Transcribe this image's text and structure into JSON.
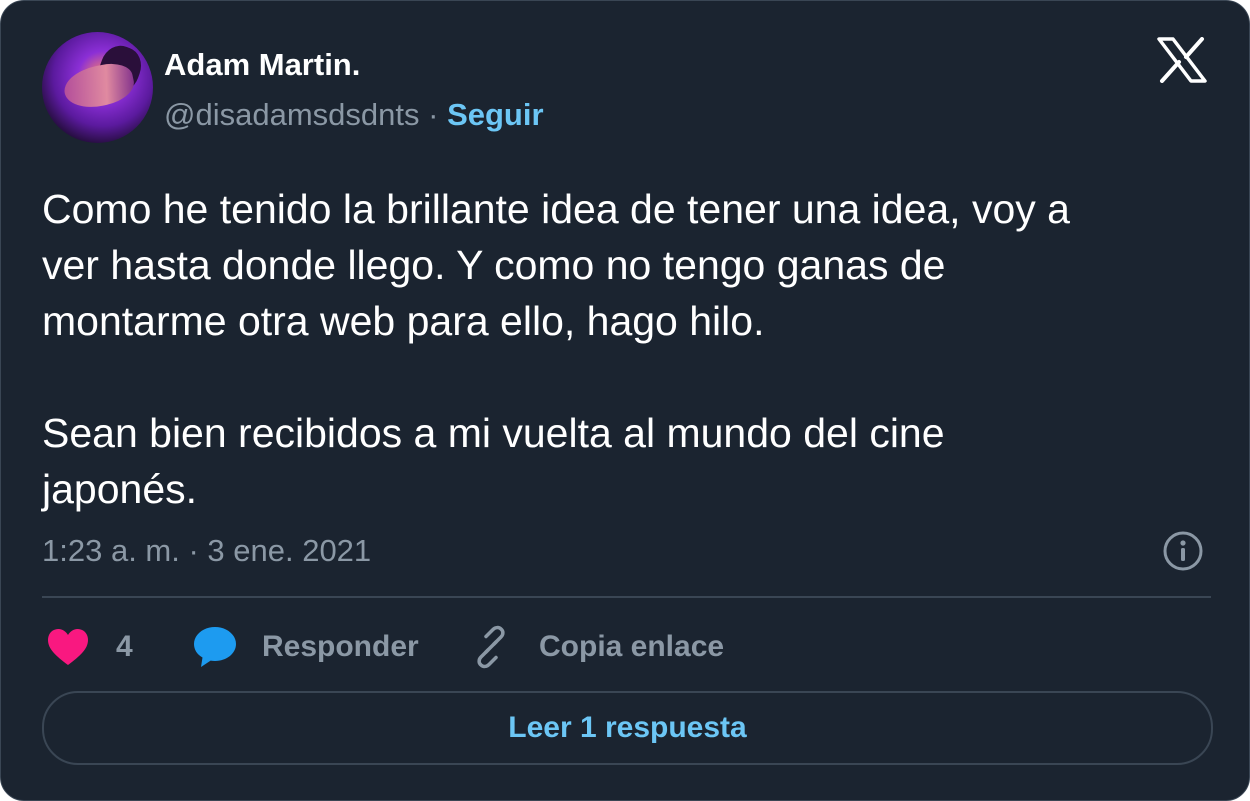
{
  "author": {
    "name": "Adam Martin.",
    "handle": "@disadamsdsdnts",
    "separator": "·",
    "follow_label": "Seguir"
  },
  "tweet": {
    "text": "Como he tenido la brillante idea de tener una idea, voy a\nver hasta donde llego. Y como no tengo ganas de\nmontarme otra web para ello, hago hilo.\n\nSean bien recibidos a mi vuelta al mundo del cine\njaponés.",
    "timestamp": "1:23 a. m. · 3 ene. 2021"
  },
  "actions": {
    "like_count": "4",
    "reply_label": "Responder",
    "copy_label": "Copia enlace"
  },
  "read_replies_label": "Leer 1 respuesta",
  "icons": {
    "logo": "x-logo-icon",
    "info": "info-icon",
    "like": "heart-icon",
    "reply": "speech-bubble-icon",
    "copy": "link-icon"
  },
  "colors": {
    "background": "#1b2430",
    "accent": "#6cc6f5",
    "like": "#f91880",
    "reply": "#1d9bf0",
    "muted": "#8b98a5"
  }
}
